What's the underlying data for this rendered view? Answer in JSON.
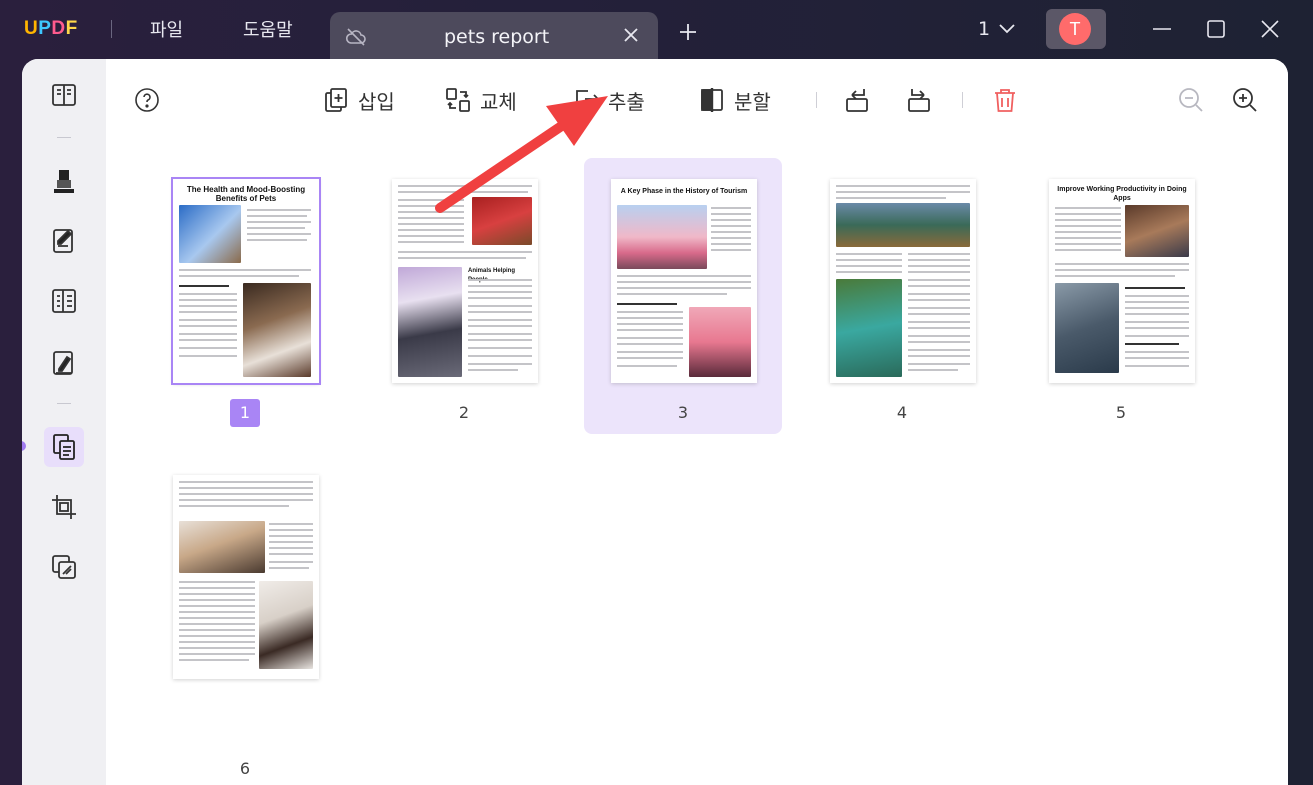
{
  "app": {
    "logo": {
      "u": "U",
      "p": "P",
      "d": "D",
      "f": "F"
    },
    "menu": [
      "파일",
      "도움말"
    ],
    "tab_title": "pets report",
    "page_indicator": "1",
    "user_initial": "T"
  },
  "toolbar": {
    "insert": "삽입",
    "replace": "교체",
    "extract": "추출",
    "split": "분할"
  },
  "pages": [
    {
      "label": "1",
      "title": "The Health and Mood-Boosting Benefits of Pets",
      "current": true
    },
    {
      "label": "2",
      "title": "Animals Helping People",
      "current": false
    },
    {
      "label": "3",
      "title": "A Key Phase in the History of Tourism",
      "current": false,
      "selected": true
    },
    {
      "label": "4",
      "title": "",
      "current": false
    },
    {
      "label": "5",
      "title": "Improve Working Productivity in Doing Apps",
      "current": false
    },
    {
      "label": "6",
      "title": "",
      "current": false
    }
  ],
  "colors": {
    "accent": "#a985f5",
    "selected_bg": "#ece4fb",
    "arrow": "#f04040",
    "delete": "#f06060"
  }
}
